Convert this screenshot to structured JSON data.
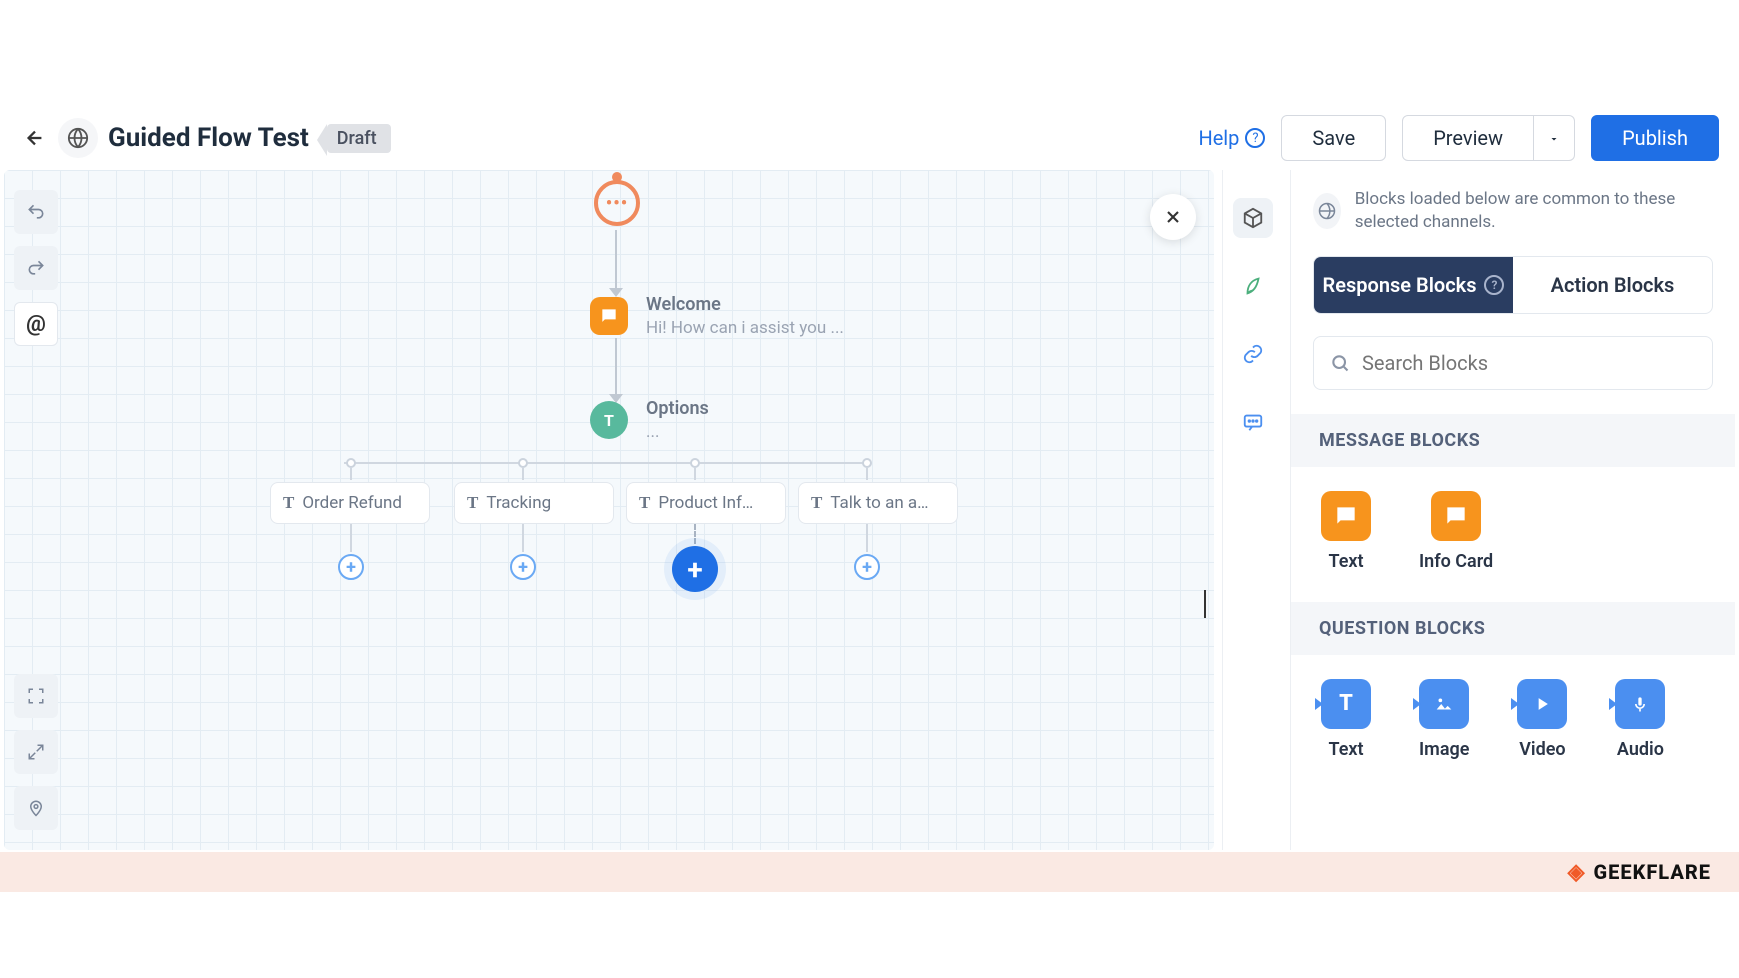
{
  "header": {
    "title": "Guided Flow Test",
    "status_tag": "Draft",
    "help_label": "Help",
    "save_label": "Save",
    "preview_label": "Preview",
    "publish_label": "Publish"
  },
  "canvas": {
    "welcome": {
      "title": "Welcome",
      "subtitle": "Hi! How can i assist you ..."
    },
    "options_node": {
      "title": "Options",
      "subtitle": "..."
    },
    "options": [
      "Order Refund",
      "Tracking",
      "Product Inf…",
      "Talk to an a…"
    ]
  },
  "panel": {
    "info_text": "Blocks loaded below are common to these selected channels.",
    "tabs": {
      "response": "Response Blocks",
      "action": "Action Blocks"
    },
    "search_placeholder": "Search Blocks",
    "sections": {
      "message": {
        "title": "MESSAGE BLOCKS",
        "items": [
          {
            "label": "Text",
            "icon": "text-icon"
          },
          {
            "label": "Info Card",
            "icon": "info-card-icon"
          }
        ]
      },
      "question": {
        "title": "QUESTION BLOCKS",
        "items": [
          {
            "label": "Text",
            "icon": "q-text-icon"
          },
          {
            "label": "Image",
            "icon": "q-image-icon"
          },
          {
            "label": "Video",
            "icon": "q-video-icon"
          },
          {
            "label": "Audio",
            "icon": "q-audio-icon"
          }
        ]
      }
    }
  },
  "footer": {
    "brand": "GEEKFLARE"
  },
  "colors": {
    "primary": "#1f6fe5",
    "accent_orange": "#f7941d",
    "dark_tab": "#2a3d61",
    "teal": "#58b99d"
  }
}
